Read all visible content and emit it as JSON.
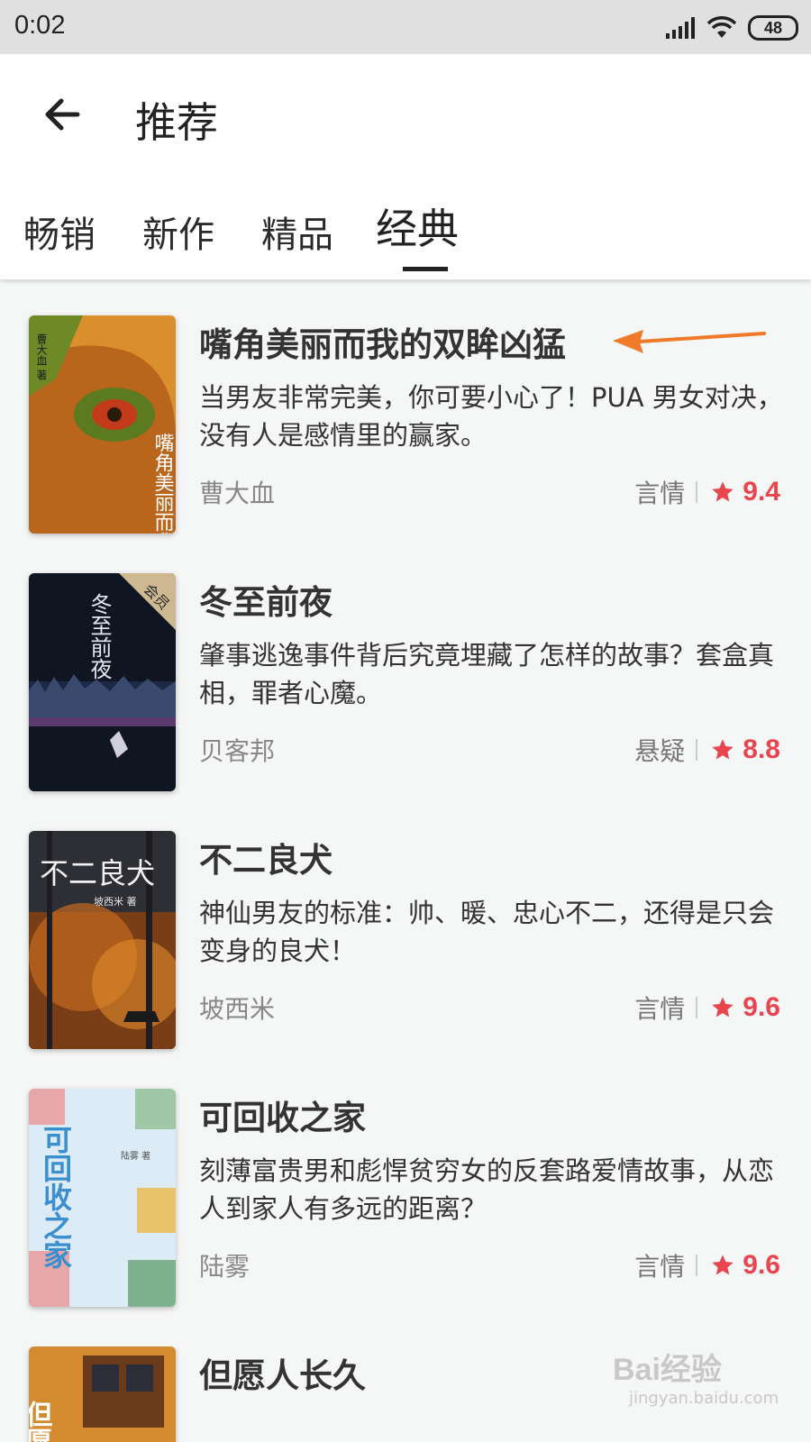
{
  "status_bar": {
    "time": "0:02",
    "battery": "48"
  },
  "header": {
    "title": "推荐",
    "back_icon": "arrow-back-icon"
  },
  "tabs": [
    {
      "label": "畅销",
      "active": false
    },
    {
      "label": "新作",
      "active": false
    },
    {
      "label": "精品",
      "active": false
    },
    {
      "label": "经典",
      "active": true
    }
  ],
  "books": [
    {
      "title": "嘴角美丽而我的双眸凶猛",
      "desc": "当男友非常完美，你可要小心了！PUA 男女对决，没有人是感情里的赢家。",
      "author": "曹大血",
      "genre": "言情",
      "rating": "9.4",
      "cover": {
        "title": "嘴角美丽而我的双眸凶猛",
        "author_mark": "曹大血 著",
        "colors": [
          "#d98f2b",
          "#9a5a1a",
          "#7a8a2a"
        ]
      }
    },
    {
      "title": "冬至前夜",
      "desc": "肇事逃逸事件背后究竟埋藏了怎样的故事？套盒真相，罪者心魔。",
      "author": "贝客邦",
      "genre": "悬疑",
      "rating": "8.8",
      "cover": {
        "title": "冬至前夜",
        "badge": "会员",
        "colors": [
          "#101522",
          "#1d2844",
          "#3e2a4e"
        ]
      }
    },
    {
      "title": "不二良犬",
      "desc": "神仙男友的标准：帅、暖、忠心不二，还得是只会变身的良犬！",
      "author": "坡西米",
      "genre": "言情",
      "rating": "9.6",
      "cover": {
        "title": "不二良犬",
        "author_mark": "坡西米 著",
        "colors": [
          "#2e2f34",
          "#a65a1e",
          "#e08a2b"
        ]
      }
    },
    {
      "title": "可回收之家",
      "desc": "刻薄富贵男和彪悍贫穷女的反套路爱情故事，从恋人到家人有多远的距离？",
      "author": "陆雾",
      "genre": "言情",
      "rating": "9.6",
      "cover": {
        "title": "可回收之家",
        "author_mark": "陆雾 著",
        "colors": [
          "#dcebf5",
          "#3a8fd0",
          "#e7a7a8"
        ]
      }
    },
    {
      "title": "但愿人长久",
      "desc": "",
      "author": "",
      "genre": "",
      "rating": "",
      "cover": {
        "title": "但愿",
        "colors": [
          "#d48a2e",
          "#6a3a1a"
        ]
      }
    }
  ],
  "colors": {
    "accent_rating": "#e8454f",
    "annotation_arrow": "#f07a2a"
  },
  "watermark": {
    "logo": "Bai经验",
    "url": "jingyan.baidu.com"
  }
}
